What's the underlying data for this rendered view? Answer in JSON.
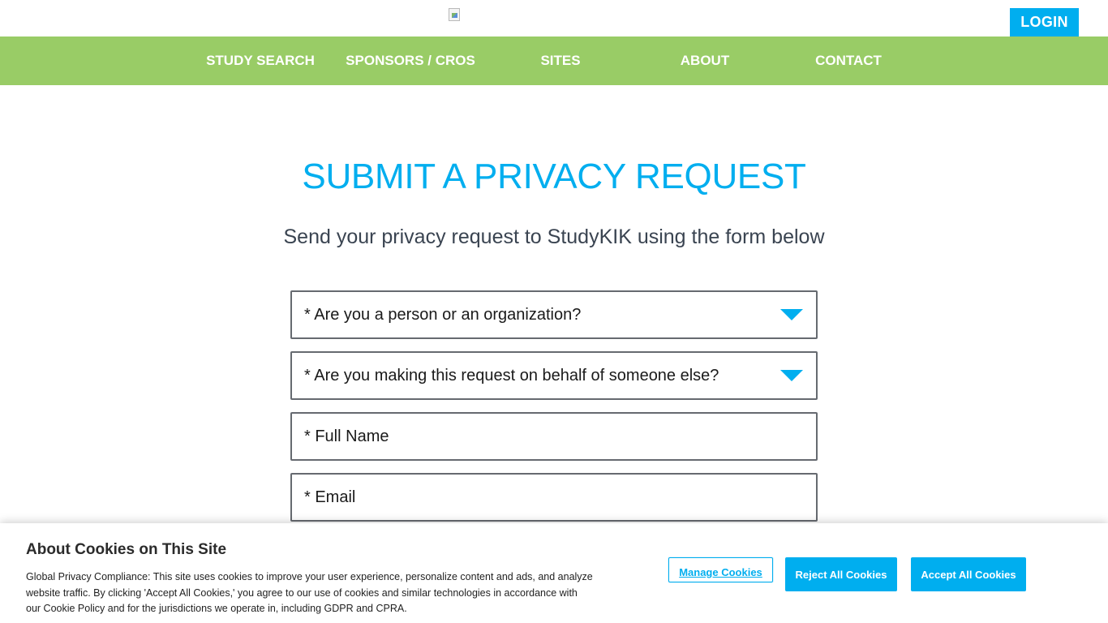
{
  "header": {
    "login_label": "LOGIN"
  },
  "nav": {
    "items": [
      {
        "label": "STUDY SEARCH"
      },
      {
        "label": "SPONSORS / CROS"
      },
      {
        "label": "SITES"
      },
      {
        "label": "ABOUT"
      },
      {
        "label": "CONTACT"
      }
    ]
  },
  "main": {
    "title": "SUBMIT A PRIVACY REQUEST",
    "subtitle": "Send your privacy request to StudyKIK using the form below"
  },
  "form": {
    "person_or_org_label": "* Are you a person or an organization?",
    "on_behalf_label": "* Are you making this request on behalf of someone else?",
    "full_name_placeholder": "* Full Name",
    "email_placeholder": "* Email"
  },
  "cookie_banner": {
    "title": "About Cookies on This Site",
    "text": "Global Privacy Compliance: This site uses cookies to improve your user experience, personalize content and ads, and analyze website traffic. By clicking 'Accept All Cookies,' you agree to our use of cookies and similar technologies in accordance with our Cookie Policy and for the jurisdictions we operate in, including GDPR and CPRA.",
    "manage_label": "Manage Cookies",
    "reject_label": "Reject All Cookies",
    "accept_label": "Accept All Cookies"
  },
  "colors": {
    "accent": "#00aeef",
    "nav_bg": "#99cc66",
    "text_dark": "#3a4451"
  },
  "icons": {
    "logo": "broken-image-icon",
    "dropdown": "caret-down-icon"
  }
}
